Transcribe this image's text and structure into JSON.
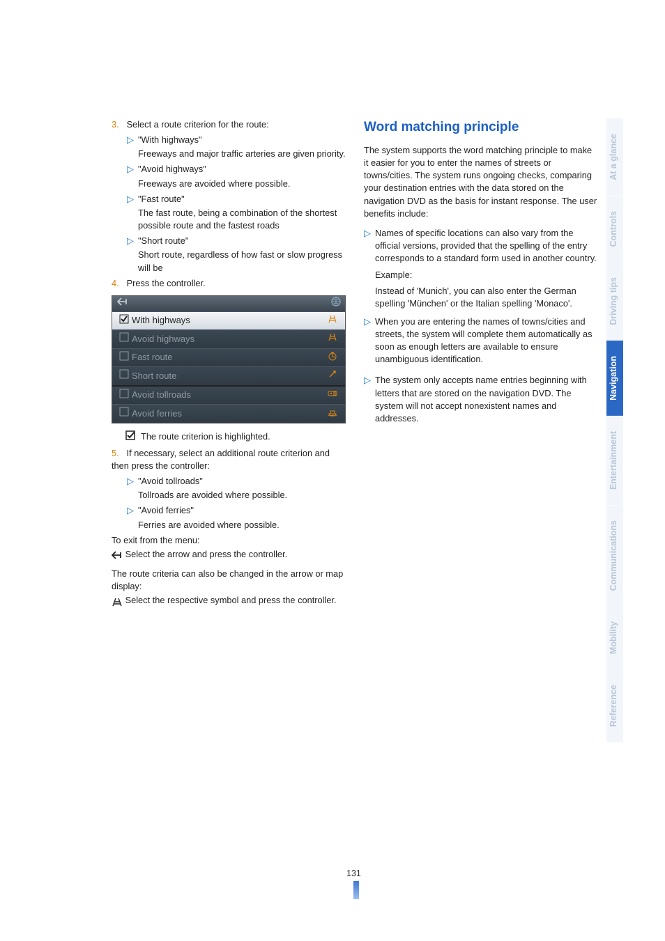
{
  "sidebar": {
    "tabs": [
      {
        "label": "At a glance"
      },
      {
        "label": "Controls"
      },
      {
        "label": "Driving tips"
      },
      {
        "label": "Navigation",
        "active": true
      },
      {
        "label": "Entertainment"
      },
      {
        "label": "Communications"
      },
      {
        "label": "Mobility"
      },
      {
        "label": "Reference"
      }
    ]
  },
  "left": {
    "step3": {
      "num": "3.",
      "lead": "Select a route criterion for the route:",
      "items": [
        {
          "q": "\"With highways\"",
          "d": "Freeways and major traffic arteries are given priority."
        },
        {
          "q": "\"Avoid highways\"",
          "d": "Freeways are avoided where possible."
        },
        {
          "q": "\"Fast route\"",
          "d": "The fast route, being a combination of the shortest possible route and the fastest roads"
        },
        {
          "q": "\"Short route\"",
          "d": "Short route, regardless of how fast or slow progress will be"
        }
      ]
    },
    "step4": {
      "num": "4.",
      "text": "Press the controller."
    },
    "figure": {
      "rows": [
        {
          "chk": "check",
          "label": "With highways",
          "icon": "grid",
          "sel": true
        },
        {
          "chk": "box",
          "label": "Avoid highways",
          "icon": "grid"
        },
        {
          "chk": "box",
          "label": "Fast route",
          "icon": "clock"
        },
        {
          "chk": "box",
          "label": "Short route",
          "icon": "arrow"
        },
        {
          "chk": "box",
          "label": "Avoid tollroads",
          "icon": "toll"
        },
        {
          "chk": "box",
          "label": "Avoid ferries",
          "icon": "ferry"
        }
      ]
    },
    "caption": "The route criterion is highlighted.",
    "step5": {
      "num": "5.",
      "lead": "If necessary, select an additional route criterion and then press the controller:",
      "items": [
        {
          "q": "\"Avoid tollroads\"",
          "d": "Tollroads are avoided where possible."
        },
        {
          "q": "\"Avoid ferries\"",
          "d": "Ferries are avoided where possible."
        }
      ]
    },
    "exit_lead": "To exit from the menu:",
    "exit_text": "Select the arrow and press the controller.",
    "change_lead": "The route criteria can also be changed in the arrow or map display:",
    "change_text": "Select the respective symbol and press the controller."
  },
  "right": {
    "heading": "Word matching principle",
    "para1": "The system supports the word matching principle to make it easier for you to enter the names of streets or towns/cities. The system runs ongoing checks, comparing your destination entries with the data stored on the navigation DVD as the basis for instant response. The user benefits include:",
    "b1": "Names of specific locations can also vary from the official versions, provided that the spelling of the entry corresponds to a standard form used in another country.",
    "ex_label": "Example:",
    "ex_text": "Instead of 'Munich', you can also enter the German spelling 'München' or the Italian spelling 'Monaco'.",
    "b2": "When you are entering the names of towns/cities and streets, the system will complete them automatically as soon as enough letters are available to ensure unambiguous identification.",
    "b3": "The system only accepts name entries beginning with letters that are stored on the navigation DVD. The system will not accept nonexistent names and addresses."
  },
  "page_number": "131"
}
